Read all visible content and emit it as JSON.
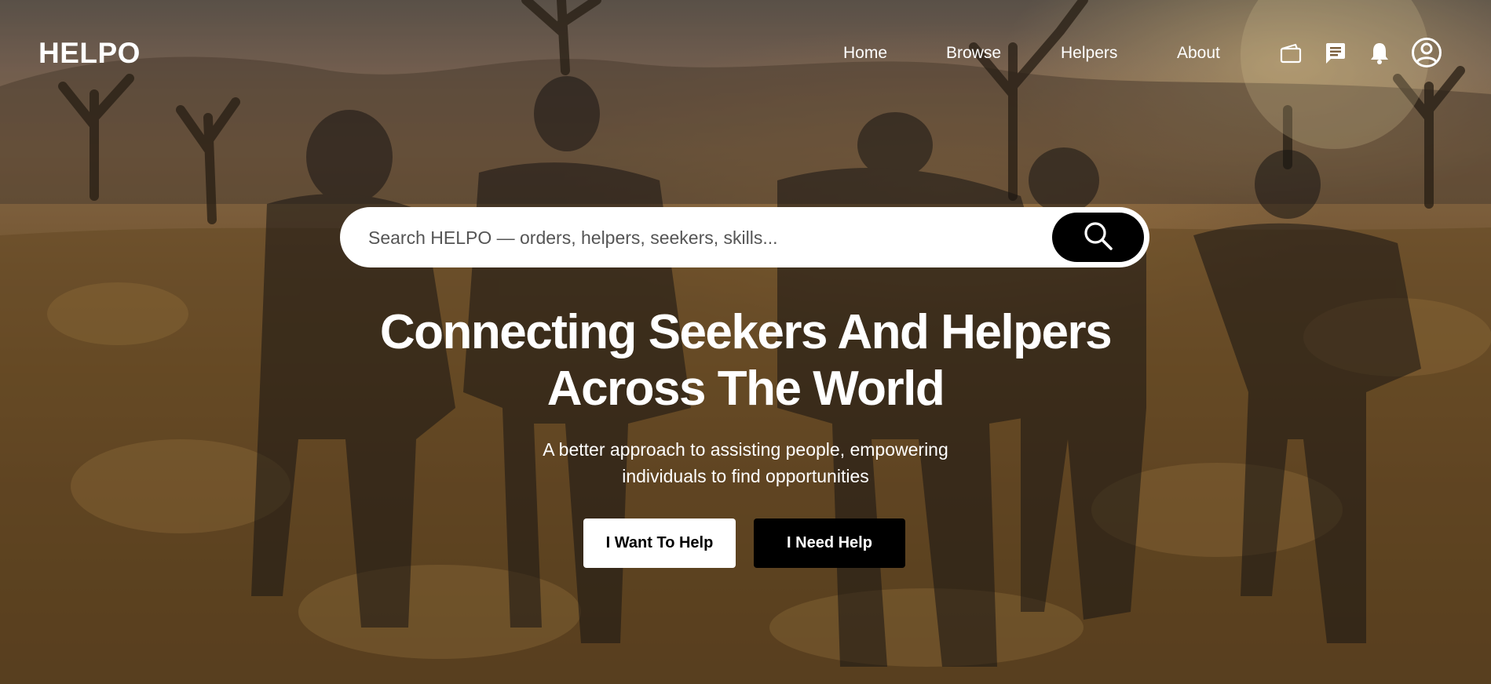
{
  "brand": {
    "name": "HELPO"
  },
  "nav": {
    "links": [
      {
        "label": "Home"
      },
      {
        "label": "Browse"
      },
      {
        "label": "Helpers"
      },
      {
        "label": "About"
      }
    ],
    "icons": [
      "wallet-icon",
      "chat-icon",
      "bell-icon",
      "user-circle-icon"
    ]
  },
  "search": {
    "placeholder": "Search HELPO — orders, helpers, seekers, skills...",
    "value": "",
    "button_icon": "search-icon"
  },
  "hero": {
    "headline_line1": "Connecting Seekers And Helpers",
    "headline_line2": "Across The World",
    "subtitle_line1": "A better approach to assisting people, empowering",
    "subtitle_line2": "individuals to find opportunities",
    "cta_help": "I Want To Help",
    "cta_need": "I Need Help"
  },
  "colors": {
    "text": "#ffffff",
    "primary_button_bg": "#000000",
    "secondary_button_bg": "#ffffff"
  }
}
